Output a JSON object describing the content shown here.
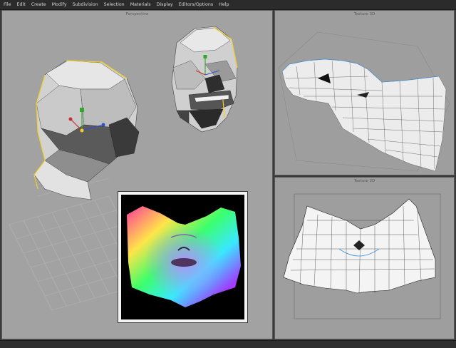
{
  "menubar": {
    "items": [
      "File",
      "Edit",
      "Create",
      "Modify",
      "Subdivision",
      "Selection",
      "Materials",
      "Display",
      "Editors/Options",
      "Help"
    ]
  },
  "viewports": {
    "perspective": {
      "title": "Perspective"
    },
    "texture3d": {
      "title": "Texture 3D"
    },
    "texture2d": {
      "title": "Texture 2D"
    }
  },
  "colors": {
    "menubar_bg": "#2b2b2b",
    "viewport_bg": "#a2a2a2",
    "seam": "#f0d020",
    "uv_edge": "#1e1e1e",
    "selected_edge": "#3f8ed8"
  },
  "icons": [
    "head-mesh-back",
    "head-mesh-front",
    "transform-gizmo",
    "uv-map-3d",
    "uv-map-2d",
    "normal-map-render"
  ]
}
